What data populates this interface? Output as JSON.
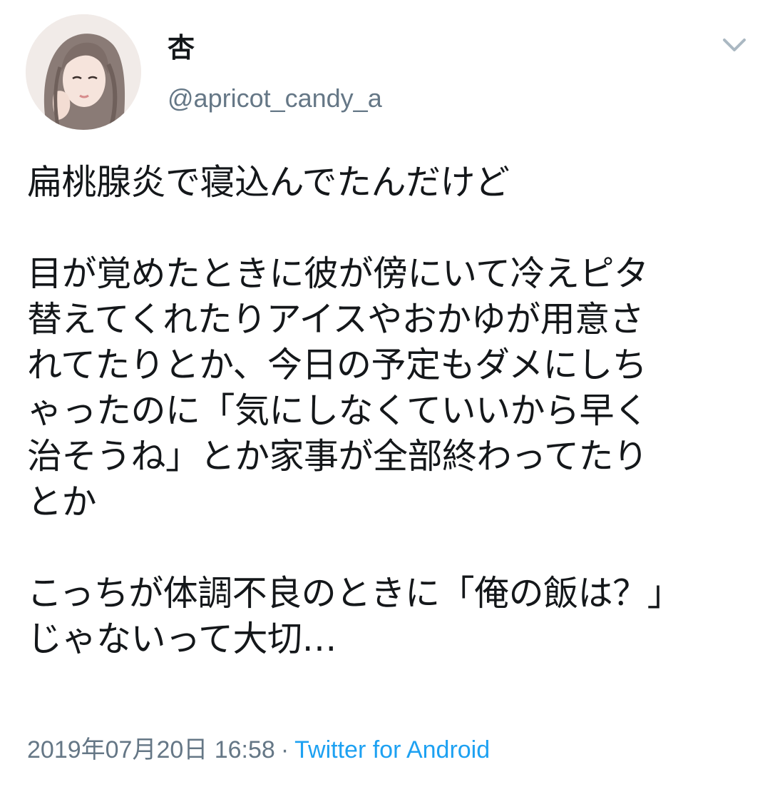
{
  "tweet": {
    "display_name": "杏",
    "handle": "@apricot_candy_a",
    "text": "扁桃腺炎で寝込んでたんだけど\n\n目が覚めたときに彼が傍にいて冷えピタ\n替えてくれたりアイスやおかゆが用意さ\nれてたりとか、今日の予定もダメにしち\nゃったのに「気にしなくていいから早く\n治そうね」とか家事が全部終わってたり\nとか\n\nこっちが体調不良のときに「俺の飯は？」\nじゃないって大切…",
    "timestamp": "2019年07月20日 16:58",
    "separator": "·",
    "source": "Twitter for Android"
  },
  "icons": {
    "menu": "chevron-down-icon",
    "avatar": "avatar-illustration"
  },
  "colors": {
    "text": "#14171a",
    "secondary": "#657786",
    "link": "#1da1f2",
    "background": "#ffffff"
  }
}
